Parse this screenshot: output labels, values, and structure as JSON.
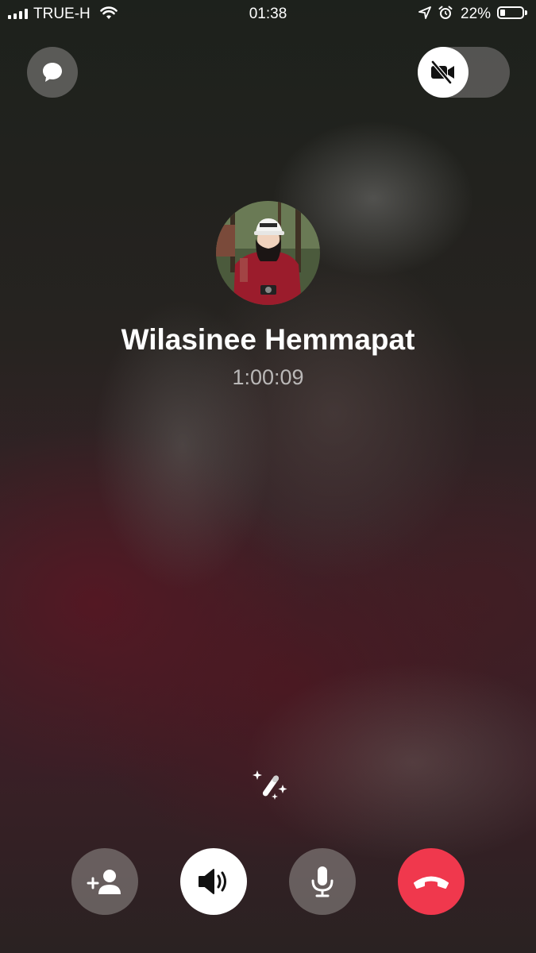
{
  "status_bar": {
    "carrier": "TRUE-H",
    "time": "01:38",
    "battery_percent": "22%",
    "battery_level": 0.22,
    "icons": [
      "signal-icon",
      "wifi-icon",
      "location-icon",
      "alarm-icon",
      "battery-icon"
    ]
  },
  "top_controls": {
    "chat_icon": "chat-bubble-icon",
    "video_icon": "video-off-icon",
    "video_enabled": false
  },
  "caller": {
    "name": "Wilasinee Hemmapat",
    "duration": "1:00:09"
  },
  "effects_icon": "magic-wand-icon",
  "controls": [
    {
      "id": "add-person",
      "icon": "add-person-icon"
    },
    {
      "id": "speaker",
      "icon": "speaker-icon",
      "active": true
    },
    {
      "id": "mic",
      "icon": "microphone-icon"
    },
    {
      "id": "end-call",
      "icon": "hang-up-icon"
    }
  ],
  "colors": {
    "end_call": "#f0384d",
    "control_bg": "#96918e",
    "background": "#2a2424"
  }
}
